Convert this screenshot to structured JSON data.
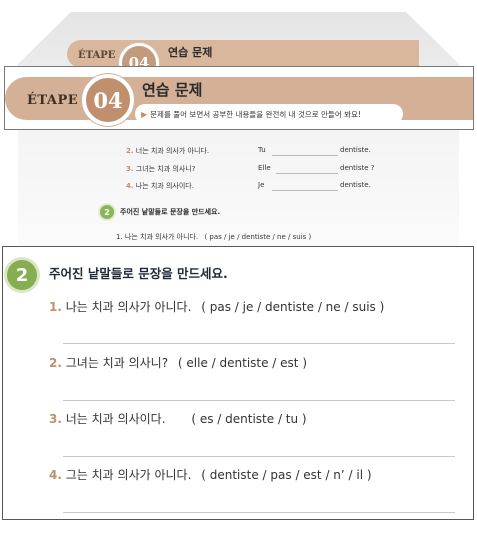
{
  "header": {
    "etape": "ÉTAPE",
    "number": "04",
    "title": "연습 문제",
    "subtitle": "문제를 풀어 보면서 공부한 내용들을 완전히 내 것으로 만들어 봐요!"
  },
  "exercise1_rows": [
    {
      "num": "2.",
      "korean": "너는 치과 의사가 아니다.",
      "pronoun": "Tu",
      "end": "dentiste."
    },
    {
      "num": "3.",
      "korean": "그녀는 치과 의사니?",
      "pronoun": "Elle",
      "end": "dentiste ?"
    },
    {
      "num": "4.",
      "korean": "나는 치과 의사이다.",
      "pronoun": "Je",
      "end": "dentiste."
    }
  ],
  "section2": {
    "number": "2",
    "title": "주어진 낱말들로 문장을 만드세요.",
    "questions": [
      {
        "num": "1.",
        "korean": "나는 치과 의사가 아니다.",
        "words": "( pas / je / dentiste / ne / suis )"
      },
      {
        "num": "2.",
        "korean": "그녀는 치과 의사니?",
        "words": "( elle / dentiste / est )"
      },
      {
        "num": "3.",
        "korean": "너는 치과 의사이다.",
        "words": "( es / dentiste / tu )"
      },
      {
        "num": "4.",
        "korean": "그는 치과 의사가 아니다.",
        "words": "( dentiste / pas / est / n’ / il )"
      }
    ]
  }
}
